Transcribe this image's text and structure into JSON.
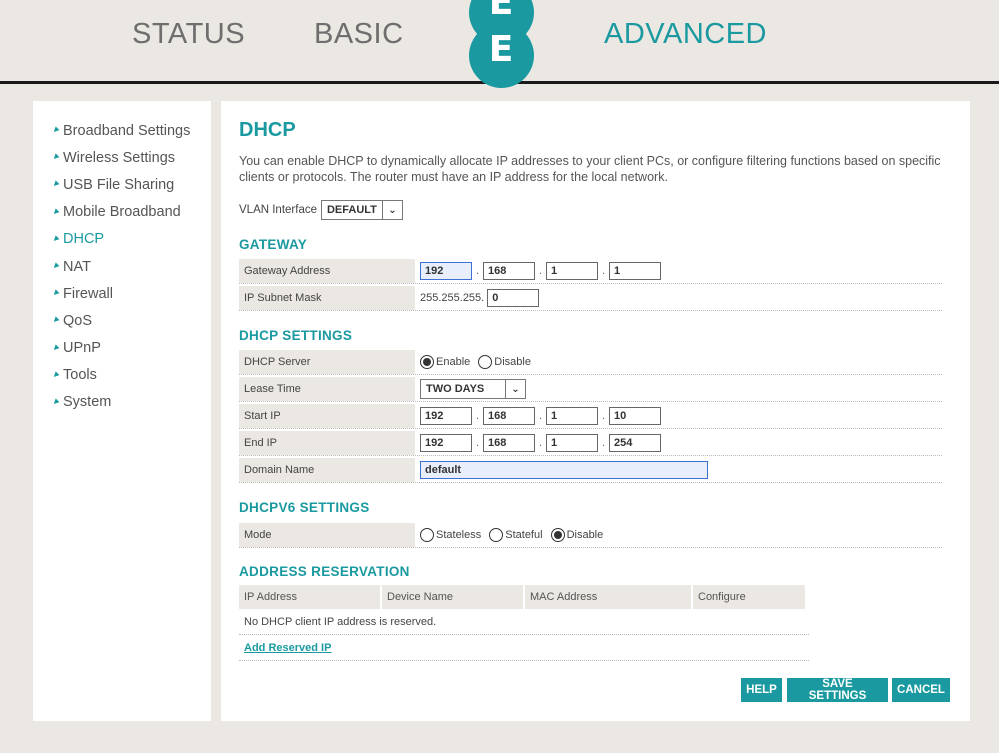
{
  "topnav": {
    "status": "STATUS",
    "basic": "BASIC",
    "advanced": "ADVANCED",
    "logo": "EE"
  },
  "sidebar": {
    "items": [
      {
        "label": "Broadband Settings"
      },
      {
        "label": "Wireless Settings"
      },
      {
        "label": "USB File Sharing"
      },
      {
        "label": "Mobile Broadband"
      },
      {
        "label": "DHCP"
      },
      {
        "label": "NAT"
      },
      {
        "label": "Firewall"
      },
      {
        "label": "QoS"
      },
      {
        "label": "UPnP"
      },
      {
        "label": "Tools"
      },
      {
        "label": "System"
      }
    ],
    "active": "DHCP",
    "arrow_glyph": "➘"
  },
  "page": {
    "title": "DHCP",
    "intro": "You can enable DHCP to dynamically allocate IP addresses to your client PCs, or configure filtering functions based on specific clients or protocols. The router must have an IP address for the local network.",
    "vlan_label": "VLAN Interface",
    "vlan_value": "DEFAULT"
  },
  "gateway": {
    "title": "GATEWAY",
    "address_label": "Gateway Address",
    "address": [
      "192",
      "168",
      "1",
      "1"
    ],
    "mask_label": "IP Subnet Mask",
    "mask_prefix": "255.255.255.",
    "mask_last": "0"
  },
  "dhcp": {
    "title": "DHCP SETTINGS",
    "server_label": "DHCP Server",
    "server_enable": "Enable",
    "server_disable": "Disable",
    "lease_label": "Lease Time",
    "lease_value": "TWO DAYS",
    "start_label": "Start IP",
    "start_ip": [
      "192",
      "168",
      "1",
      "10"
    ],
    "end_label": "End IP",
    "end_ip": [
      "192",
      "168",
      "1",
      "254"
    ],
    "domain_label": "Domain Name",
    "domain_value": "default"
  },
  "dhcpv6": {
    "title": "DHCPV6 SETTINGS",
    "mode_label": "Mode",
    "stateless": "Stateless",
    "stateful": "Stateful",
    "disable": "Disable"
  },
  "reservation": {
    "title": "ADDRESS RESERVATION",
    "columns": [
      "IP Address",
      "Device Name",
      "MAC Address",
      "Configure"
    ],
    "empty_message": "No DHCP client IP address is reserved.",
    "add_link": "Add Reserved IP"
  },
  "buttons": {
    "help": "HELP",
    "save": "SAVE SETTINGS",
    "cancel": "CANCEL"
  },
  "colors": {
    "accent": "#1a9aa0",
    "background": "#ebe7e2"
  }
}
